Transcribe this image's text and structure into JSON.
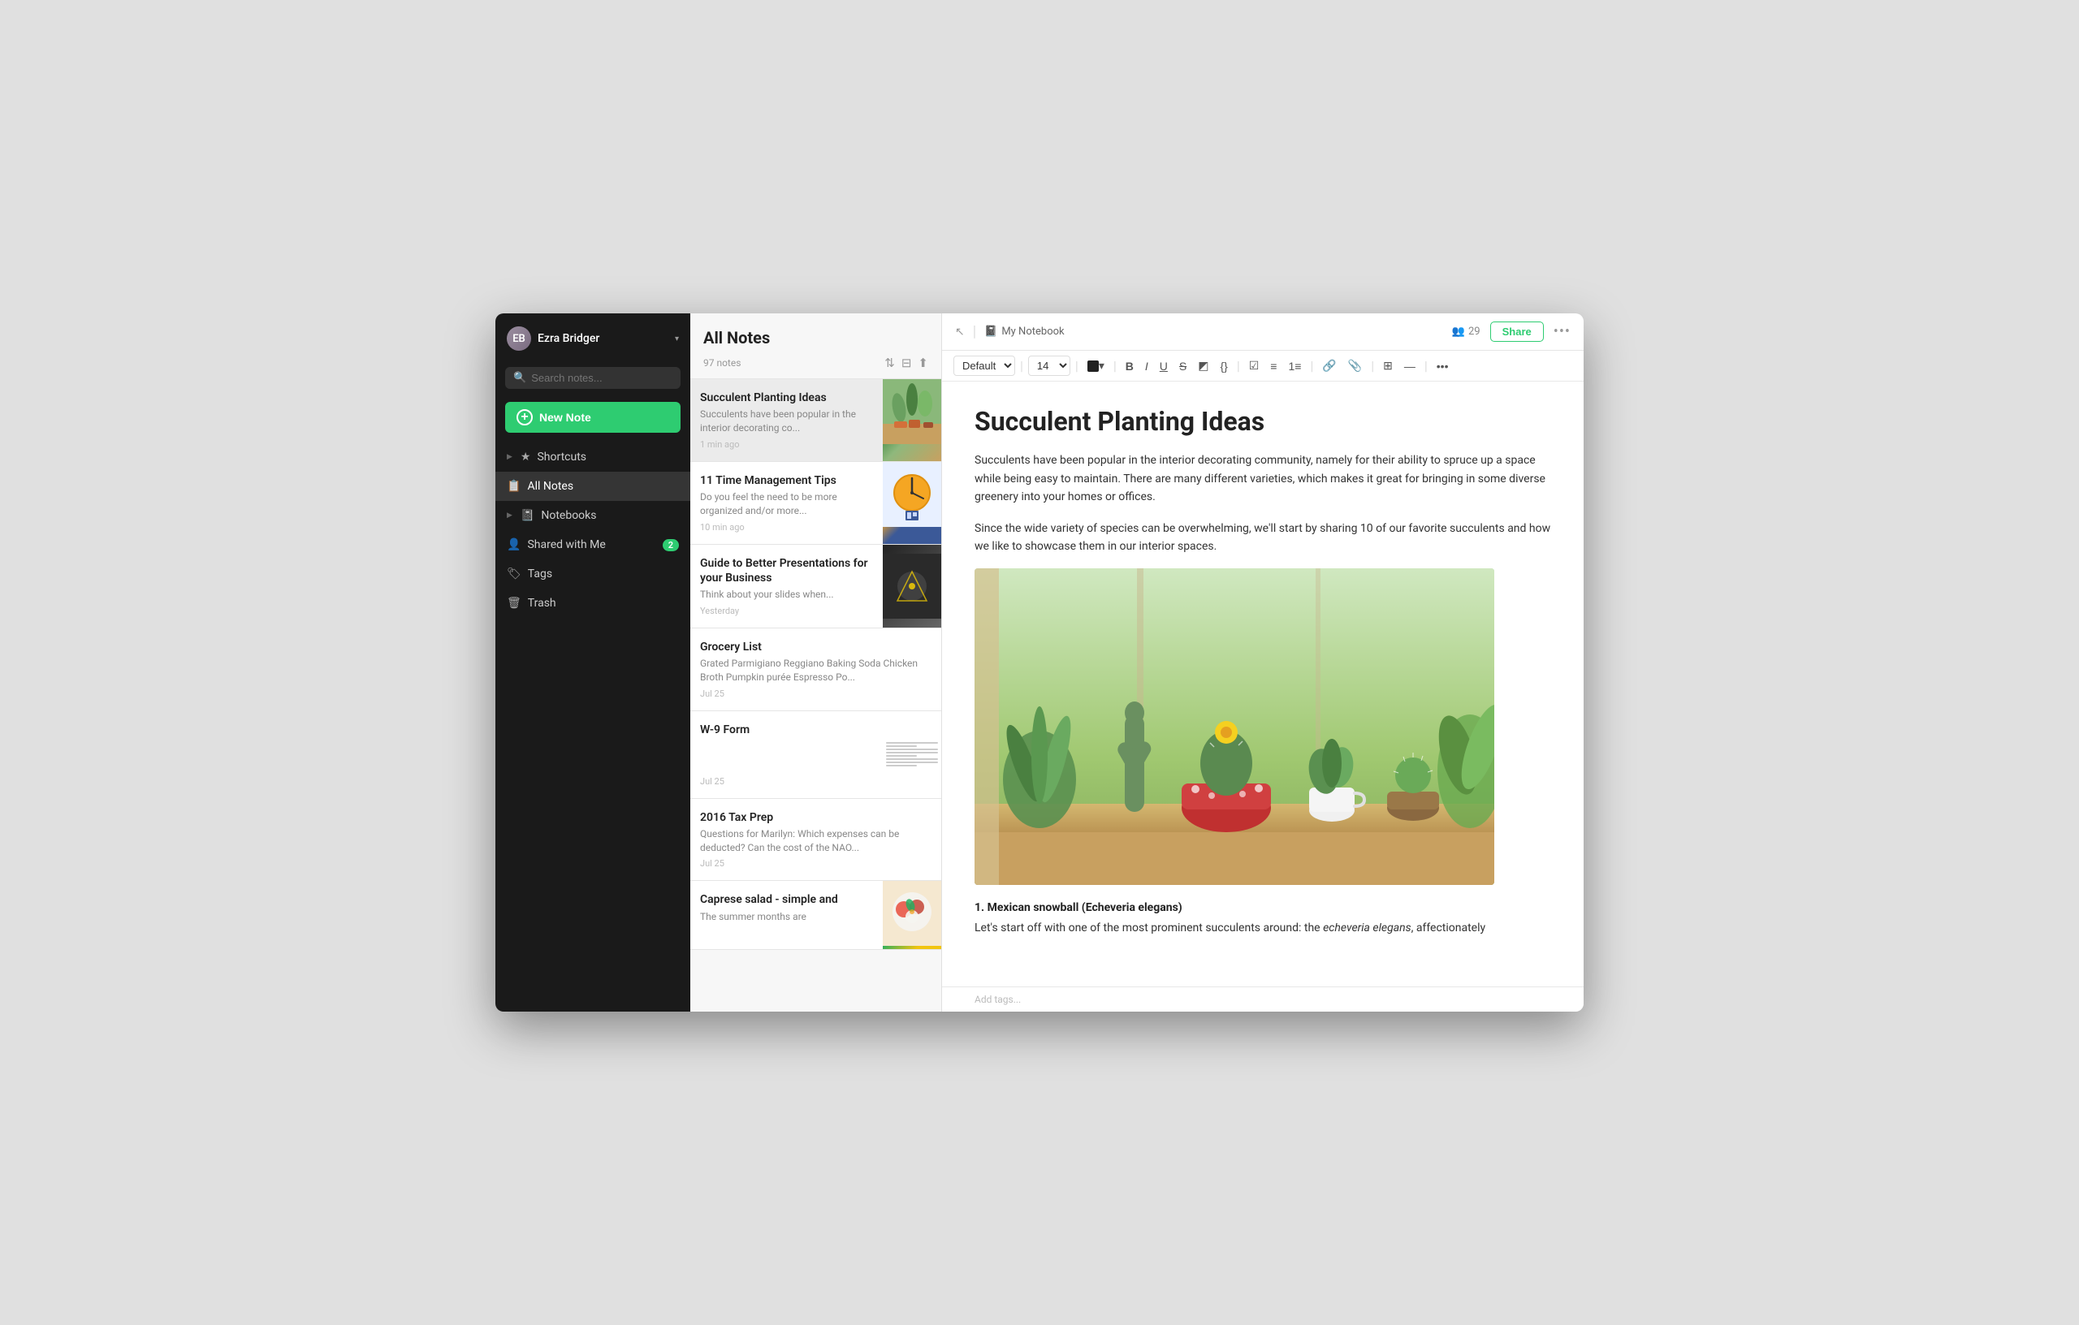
{
  "sidebar": {
    "user": {
      "name": "Ezra Bridger",
      "avatar_initials": "EB"
    },
    "search": {
      "placeholder": "Search notes..."
    },
    "new_note_label": "New Note",
    "nav": [
      {
        "id": "shortcuts",
        "label": "Shortcuts",
        "icon": "★",
        "arrow": true,
        "badge": null
      },
      {
        "id": "all-notes",
        "label": "All Notes",
        "icon": "☰",
        "arrow": false,
        "badge": null,
        "active": true
      },
      {
        "id": "notebooks",
        "label": "Notebooks",
        "icon": "📓",
        "arrow": true,
        "badge": null
      },
      {
        "id": "shared",
        "label": "Shared with Me",
        "icon": "👤",
        "arrow": false,
        "badge": "2"
      },
      {
        "id": "tags",
        "label": "Tags",
        "icon": "🏷",
        "arrow": false,
        "badge": null
      },
      {
        "id": "trash",
        "label": "Trash",
        "icon": "🗑",
        "arrow": false,
        "badge": null
      }
    ]
  },
  "notes_list": {
    "title": "All Notes",
    "count": "97 notes",
    "notes": [
      {
        "id": "succulent",
        "title": "Succulent Planting Ideas",
        "preview": "Succulents have been popular in the interior decorating co...",
        "time": "1 min ago",
        "has_thumb": true,
        "thumb_type": "succulent"
      },
      {
        "id": "time-mgmt",
        "title": "11 Time Management Tips",
        "preview": "Do you feel the need to be more organized and/or more...",
        "time": "10 min ago",
        "has_thumb": true,
        "thumb_type": "time"
      },
      {
        "id": "presentations",
        "title": "Guide to Better Presentations for your Business",
        "preview": "Think about your slides when...",
        "time": "Yesterday",
        "has_thumb": true,
        "thumb_type": "pres"
      },
      {
        "id": "grocery",
        "title": "Grocery List",
        "preview": "Grated Parmigiano Reggiano Baking Soda Chicken Broth Pumpkin purée Espresso Po...",
        "time": "Jul 25",
        "has_thumb": false,
        "thumb_type": null
      },
      {
        "id": "w9",
        "title": "W-9 Form",
        "preview": "",
        "time": "Jul 25",
        "has_thumb": true,
        "thumb_type": "form"
      },
      {
        "id": "tax",
        "title": "2016 Tax Prep",
        "preview": "Questions for Marilyn: Which expenses can be deducted? Can the cost of the NAO...",
        "time": "Jul 25",
        "has_thumb": false,
        "thumb_type": null
      },
      {
        "id": "caprese",
        "title": "Caprese salad - simple and",
        "preview": "The summer months are",
        "time": "",
        "has_thumb": true,
        "thumb_type": "caprese"
      }
    ]
  },
  "editor": {
    "toolbar": {
      "back_icon": "↖",
      "notebook_icon": "📓",
      "notebook_name": "My Notebook",
      "collab_icon": "👥",
      "collab_count": "29",
      "share_label": "Share",
      "more_icon": "•••"
    },
    "format_bar": {
      "font": "Default",
      "size": "14",
      "color": "#222222",
      "bold": "B",
      "italic": "I",
      "underline": "U",
      "strikethrough": "S",
      "code": "</>",
      "checkbox": "☑",
      "ul": "≡",
      "ol": "≡",
      "link": "🔗",
      "attach": "📎",
      "table": "⊞",
      "divider": "—",
      "more": "•••"
    },
    "note": {
      "title": "Succulent Planting Ideas",
      "body1": "Succulents have been popular in the interior decorating community, namely for their ability to spruce up a space while being easy to maintain. There are many different varieties, which makes it great for bringing in some diverse greenery into your homes or offices.",
      "body2": "Since the wide variety of species can be overwhelming, we'll start by sharing 10 of our favorite succulents and how we like to showcase them in our interior spaces.",
      "section_title": "1. Mexican snowball (Echeveria elegans)",
      "section_body": "Let's start off with one of the most prominent succulents around: the echeveria elegans, affectionately",
      "tags_placeholder": "Add tags..."
    }
  }
}
